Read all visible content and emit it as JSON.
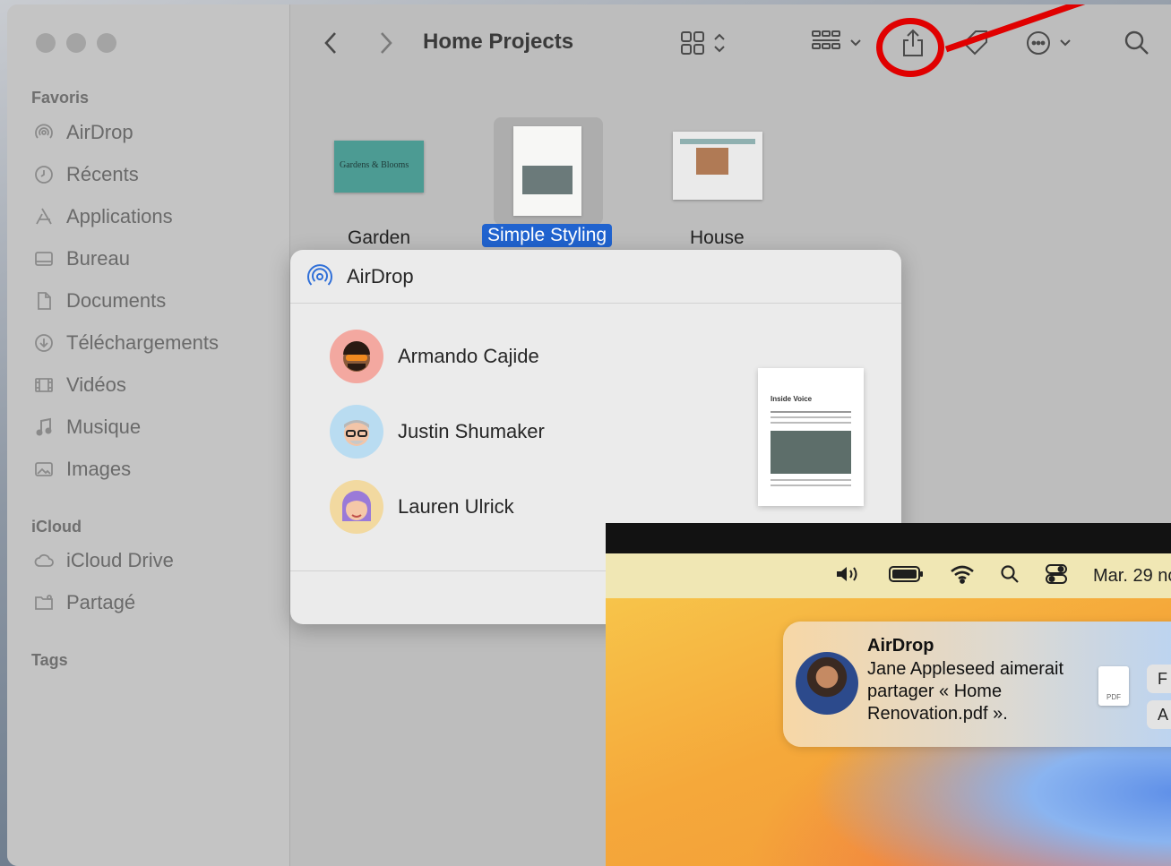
{
  "finder": {
    "title": "Home Projects",
    "sidebar": {
      "sections": [
        {
          "label": "Favoris"
        },
        {
          "label": "iCloud"
        },
        {
          "label": "Tags"
        }
      ],
      "favorites": [
        {
          "label": "AirDrop",
          "icon": "airdrop-icon"
        },
        {
          "label": "Récents",
          "icon": "clock-icon"
        },
        {
          "label": "Applications",
          "icon": "applications-icon"
        },
        {
          "label": "Bureau",
          "icon": "desktop-icon"
        },
        {
          "label": "Documents",
          "icon": "document-icon"
        },
        {
          "label": "Téléchargements",
          "icon": "download-icon"
        },
        {
          "label": "Vidéos",
          "icon": "film-icon"
        },
        {
          "label": "Musique",
          "icon": "music-icon"
        },
        {
          "label": "Images",
          "icon": "photo-icon"
        }
      ],
      "icloud": [
        {
          "label": "iCloud Drive",
          "icon": "cloud-icon"
        },
        {
          "label": "Partagé",
          "icon": "shared-folder-icon"
        }
      ]
    },
    "files": [
      {
        "name": "Garden",
        "thumb_text": "Gardens & Blooms",
        "selected": false
      },
      {
        "name": "Simple Styling",
        "selected": true
      },
      {
        "name": "House",
        "selected": false
      }
    ],
    "toolbar_icons": [
      "back-icon",
      "forward-icon",
      "grid-view-icon",
      "group-icon",
      "share-icon",
      "tag-icon",
      "more-icon",
      "search-icon"
    ]
  },
  "airdrop_popover": {
    "title": "AirDrop",
    "people": [
      {
        "name": "Armando Cajide"
      },
      {
        "name": "Justin Shumaker"
      },
      {
        "name": "Lauren Ulrick"
      }
    ],
    "preview_title": "Inside Voice"
  },
  "second_screen": {
    "clock": "Mar. 29 nc",
    "notification": {
      "title": "AirDrop",
      "message": "Jane Appleseed aimerait partager « Home Renovation.pdf ».",
      "file_badge": "PDF",
      "buttons": [
        "F",
        "A"
      ]
    }
  },
  "colors": {
    "selection": "#2063cf",
    "highlight_ring": "#e00000"
  }
}
